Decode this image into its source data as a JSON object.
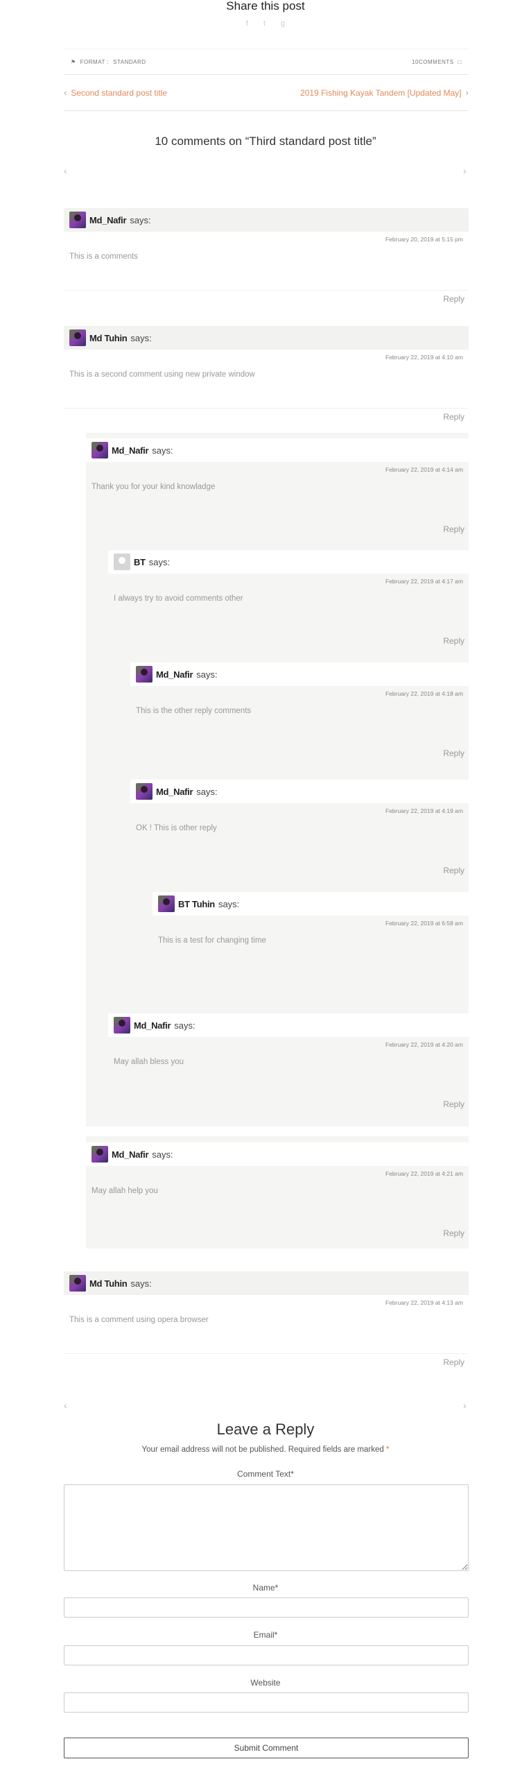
{
  "share": {
    "title": "Share this post",
    "icons": [
      "f",
      "t",
      "g"
    ]
  },
  "meta": {
    "format_label": "FORMAT :",
    "format_value": "STANDARD",
    "comments_count": "10COMMENTS"
  },
  "nav": {
    "prev": "Second standard post title",
    "next": "2019 Fishing Kayak Tandem [Updated May]"
  },
  "comments_title": "10 comments on “Third standard post title”",
  "arrows": {
    "prev": "‹",
    "next": "›"
  },
  "says": "says:",
  "reply": "Reply",
  "comments": [
    {
      "author": "Md_Nafir",
      "date": "February 20, 2019 at 5:15 pm",
      "text": "This is a comments"
    },
    {
      "author": "Md Tuhin",
      "date": "February 22, 2019 at 4:10 am",
      "text": "This is a second comment using new private window"
    },
    {
      "author": "Md_Nafir",
      "date": "February 22, 2019 at 4:14 am",
      "text": "Thank you for your kind knowladge"
    },
    {
      "author": "BT",
      "date": "February 22, 2019 at 4:17 am",
      "text": "I always try to avoid comments other"
    },
    {
      "author": "Md_Nafir",
      "date": "February 22, 2019 at 4:18 am",
      "text": "This is the other reply comments"
    },
    {
      "author": "Md_Nafir",
      "date": "February 22, 2019 at 4:19 am",
      "text": "OK ! This is other reply"
    },
    {
      "author": "BT Tuhin",
      "date": "February 22, 2019 at 6:58 am",
      "text": "This is a test for changing time"
    },
    {
      "author": "Md_Nafir",
      "date": "February 22, 2019 at 4:20 am",
      "text": "May allah bless you"
    },
    {
      "author": "Md_Nafir",
      "date": "February 22, 2019 at 4:21 am",
      "text": "May allah help you"
    },
    {
      "author": "Md Tuhin",
      "date": "February 22, 2019 at 4:13 am",
      "text": "This is a comment using opera browser"
    }
  ],
  "form": {
    "title": "Leave a Reply",
    "notice": "Your email address will not be published. Required fields are marked",
    "req_mark": "*",
    "comment_label": "Comment Text*",
    "name_label": "Name*",
    "email_label": "Email*",
    "website_label": "Website",
    "submit": "Submit Comment"
  }
}
